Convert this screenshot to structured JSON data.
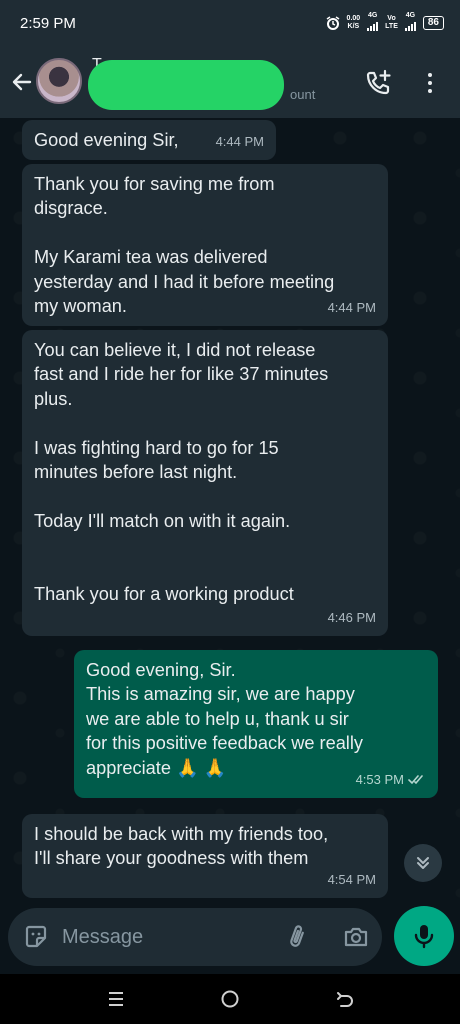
{
  "status_bar": {
    "time": "2:59 PM",
    "data_rate_top": "0.00",
    "data_rate_bottom": "K/S",
    "net1": "4G",
    "volte_top": "Vo",
    "volte_bottom": "LTE",
    "net2": "4G",
    "battery": "86"
  },
  "header": {
    "contact_initial": "T",
    "contact_subtitle": "ount",
    "icons": [
      "back-arrow-icon",
      "call-add-icon",
      "more-vert-icon"
    ]
  },
  "messages": [
    {
      "direction": "in",
      "text": "Good evening Sir,",
      "time": "4:44 PM"
    },
    {
      "direction": "in",
      "text": "Thank you for saving me from\ndisgrace.\n\nMy Karami tea was delivered\nyesterday and I had it before meeting\nmy woman.",
      "time": "4:44 PM"
    },
    {
      "direction": "in",
      "text": "You can believe it, I did not release\nfast and I ride her for like 37 minutes\nplus.\n\nI was fighting hard to go for 15\nminutes before last night.\n\nToday I'll match on with it again.\n\n\nThank you for a working product",
      "time": "4:46 PM"
    },
    {
      "direction": "out",
      "text": "Good evening, Sir.\nThis is amazing sir, we are happy\nwe  are able to help u, thank u sir\nfor this positive feedback we really\nappreciate 🙏 🙏",
      "time": "4:53 PM",
      "status": "read"
    },
    {
      "direction": "in",
      "text": "I should be back with my friends too,\nI'll share your goodness with them",
      "time": "4:54 PM"
    }
  ],
  "composer": {
    "placeholder": "Message",
    "icons": [
      "sticker-icon",
      "attach-icon",
      "camera-icon",
      "mic-icon"
    ]
  },
  "colors": {
    "header_bg": "#1f2c34",
    "chat_bg": "#0b141a",
    "incoming_bubble": "#1f2c34",
    "outgoing_bubble": "#005c4b",
    "accent": "#00a884"
  }
}
